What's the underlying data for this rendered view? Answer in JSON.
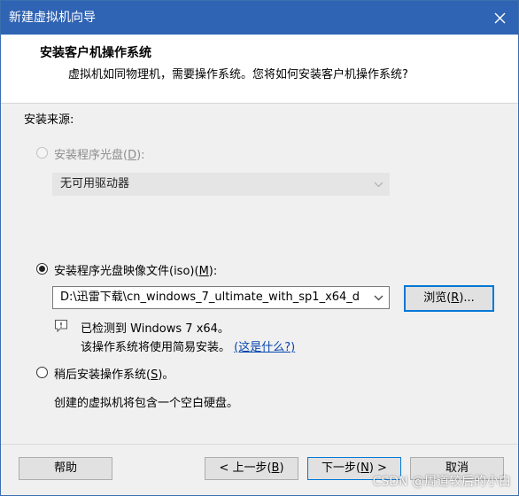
{
  "window": {
    "title": "新建虚拟机向导"
  },
  "header": {
    "title": "安装客户机操作系统",
    "subtitle": "虚拟机如同物理机，需要操作系统。您将如何安装客户机操作系统?"
  },
  "source": {
    "label": "安装来源:",
    "disc": {
      "label_before": "安装程序光盘(",
      "mnemonic": "D",
      "label_after": "):",
      "selected": false,
      "enabled": false,
      "drive_value": "无可用驱动器"
    },
    "iso": {
      "label_before": "安装程序光盘映像文件(iso)(",
      "mnemonic": "M",
      "label_after": "):",
      "selected": true,
      "path_value": "D:\\迅雷下载\\cn_windows_7_ultimate_with_sp1_x64_d",
      "browse_before": "浏览(",
      "browse_mnemonic": "R",
      "browse_after": ")...",
      "detected_line": "已检测到 Windows 7 x64。",
      "easy_install_line": "该操作系统将使用简易安装。",
      "whats_this_link": "(这是什么?)"
    },
    "later": {
      "label_before": "稍后安装操作系统(",
      "mnemonic": "S",
      "label_after": ")。",
      "selected": false,
      "description": "创建的虚拟机将包含一个空白硬盘。"
    }
  },
  "footer": {
    "help_label": "帮助",
    "back_before": "< 上一步(",
    "back_mnemonic": "B",
    "back_after": ")",
    "next_before": "下一步(",
    "next_mnemonic": "N",
    "next_after": ") >",
    "cancel_label": "取消"
  },
  "watermark": "CSDN @周道较后的小白",
  "colors": {
    "titlebar": "#2f63b4",
    "link": "#0645ad",
    "focus_border": "#0078d7"
  },
  "icons": {
    "close": "close-icon",
    "dropdown": "chevron-down-icon",
    "info": "info-message-icon"
  }
}
